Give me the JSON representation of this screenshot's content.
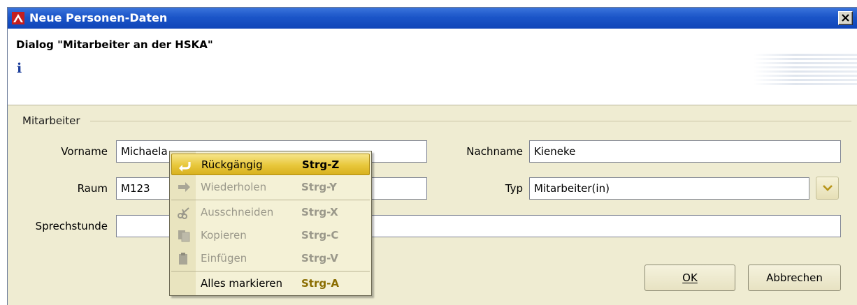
{
  "window": {
    "title": "Neue Personen-Daten",
    "icon": "app-red-triangle-icon",
    "close_icon": "close-icon"
  },
  "header": {
    "dialog_title": "Dialog \"Mitarbeiter an der HSKA\"",
    "info_glyph": "i"
  },
  "group": {
    "label": "Mitarbeiter"
  },
  "fields": {
    "vorname": {
      "label": "Vorname",
      "value": "Michaela"
    },
    "nachname": {
      "label": "Nachname",
      "value": "Kieneke"
    },
    "raum": {
      "label": "Raum",
      "value": "M123"
    },
    "typ": {
      "label": "Typ",
      "value": "Mitarbeiter(in)"
    },
    "sprechstunde": {
      "label": "Sprechstunde",
      "value": ""
    }
  },
  "buttons": {
    "ok": "OK",
    "cancel": "Abbrechen"
  },
  "context_menu": {
    "items": [
      {
        "label": "Rückgängig",
        "shortcut": "Strg-Z",
        "icon": "undo-icon",
        "enabled": true,
        "selected": true
      },
      {
        "label": "Wiederholen",
        "shortcut": "Strg-Y",
        "icon": "redo-icon",
        "enabled": false
      },
      {
        "label": "Ausschneiden",
        "shortcut": "Strg-X",
        "icon": "scissors-icon",
        "enabled": false
      },
      {
        "label": "Kopieren",
        "shortcut": "Strg-C",
        "icon": "copy-icon",
        "enabled": false
      },
      {
        "label": "Einfügen",
        "shortcut": "Strg-V",
        "icon": "paste-icon",
        "enabled": false
      },
      {
        "label": "Alles markieren",
        "shortcut": "Strg-A",
        "icon": "",
        "enabled": true
      }
    ]
  },
  "colors": {
    "titlebar": "#1b55c8",
    "dialog_bg": "#efecd2",
    "menu_highlight": "#e8c73b"
  }
}
